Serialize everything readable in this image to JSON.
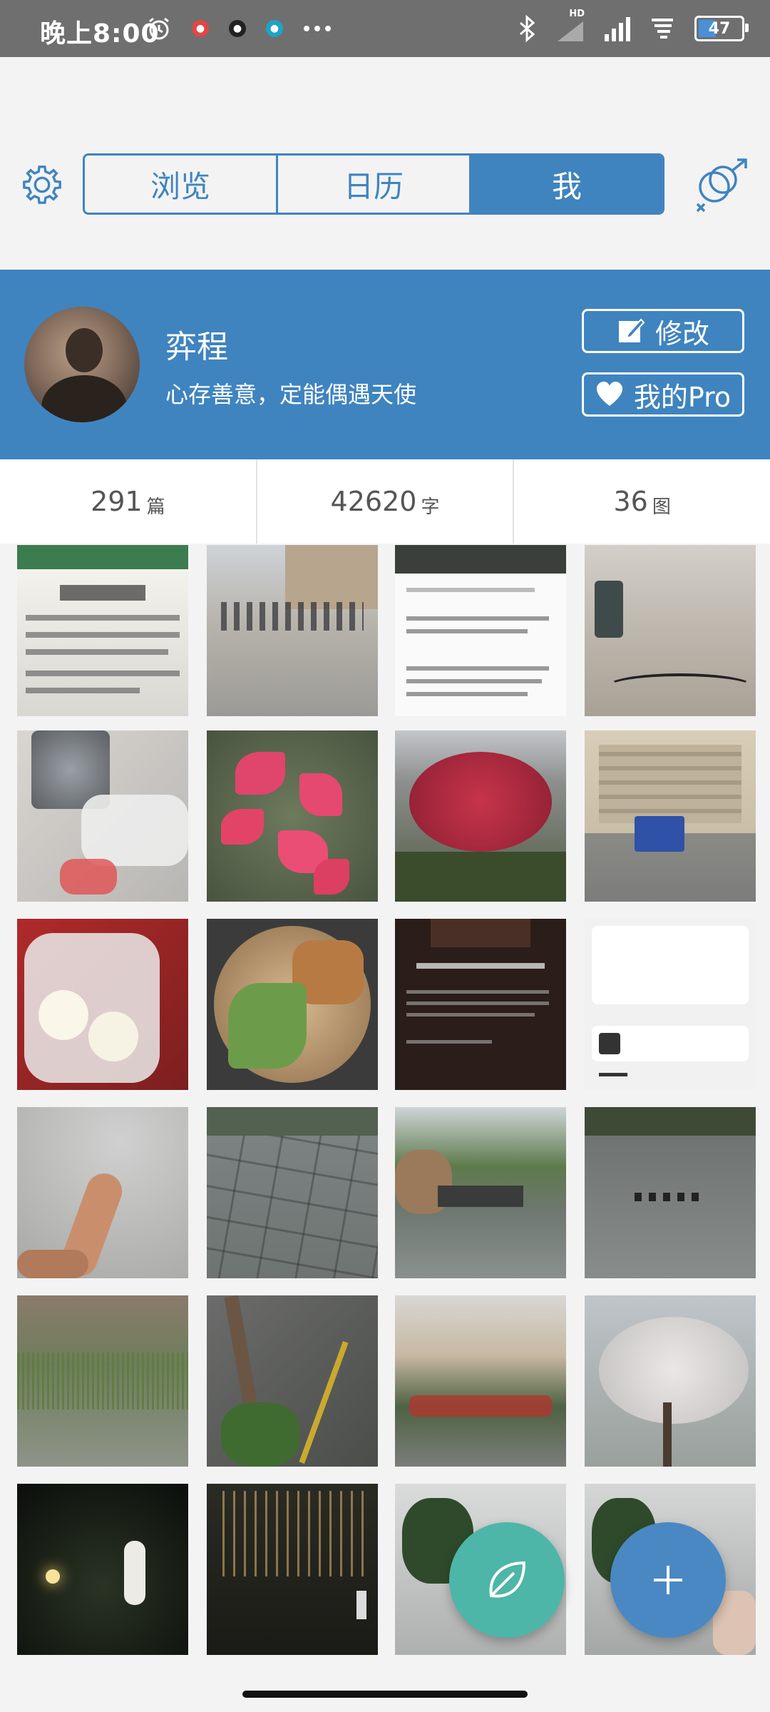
{
  "status_bar": {
    "time": "晚上8:00",
    "left_icons": [
      "alarm-icon",
      "netease-icon",
      "soul-icon",
      "zhihu-icon",
      "more-dots-icon"
    ],
    "right_icons": [
      "bluetooth-icon",
      "hd-signal-icon",
      "signal-icon",
      "wifi-icon",
      "battery-icon"
    ],
    "hd_label": "HD",
    "battery": "47",
    "battery_fraction": 0.47
  },
  "nav": {
    "tabs": [
      {
        "label": "浏览",
        "selected": false
      },
      {
        "label": "日历",
        "selected": false
      },
      {
        "label": "我",
        "selected": true
      }
    ],
    "accent": "#3f84bf"
  },
  "profile": {
    "name": "弈程",
    "bio": "心存善意，定能偶遇天使",
    "edit_label": "修改",
    "pro_label": "我的Pro"
  },
  "stats": [
    {
      "value": "291",
      "unit": "篇"
    },
    {
      "value": "42620",
      "unit": "字"
    },
    {
      "value": "36",
      "unit": "图"
    }
  ],
  "photos": {
    "row1": [
      "notice-sign-photo",
      "queue-street-photo",
      "comment-screenshot",
      "empty-room-photo"
    ],
    "row2": [
      "vacuum-bags-photo",
      "red-maple-leaves-photo",
      "red-tree-photo",
      "building-truck-photo"
    ],
    "row3": [
      "plastic-bag-buns-photo",
      "noodle-cutlet-photo",
      "dark-notice-screenshot",
      "music-app-screenshot"
    ],
    "row4": [
      "finger-photo",
      "wet-pavement-photo",
      "pond-bushes-photo",
      "ducks-pond-photo"
    ],
    "row5": [
      "reeds-pond-photo",
      "petals-road-photo",
      "garden-buildings-photo",
      "blossom-tree-photo"
    ],
    "row6": [
      "night-sparklers-photo",
      "night-buildings-photo",
      "lobby-plant-photo",
      "lobby-chairs-photo"
    ]
  },
  "fab": {
    "leaf_color": "#4db6a8",
    "add_color": "#4a88c3"
  }
}
